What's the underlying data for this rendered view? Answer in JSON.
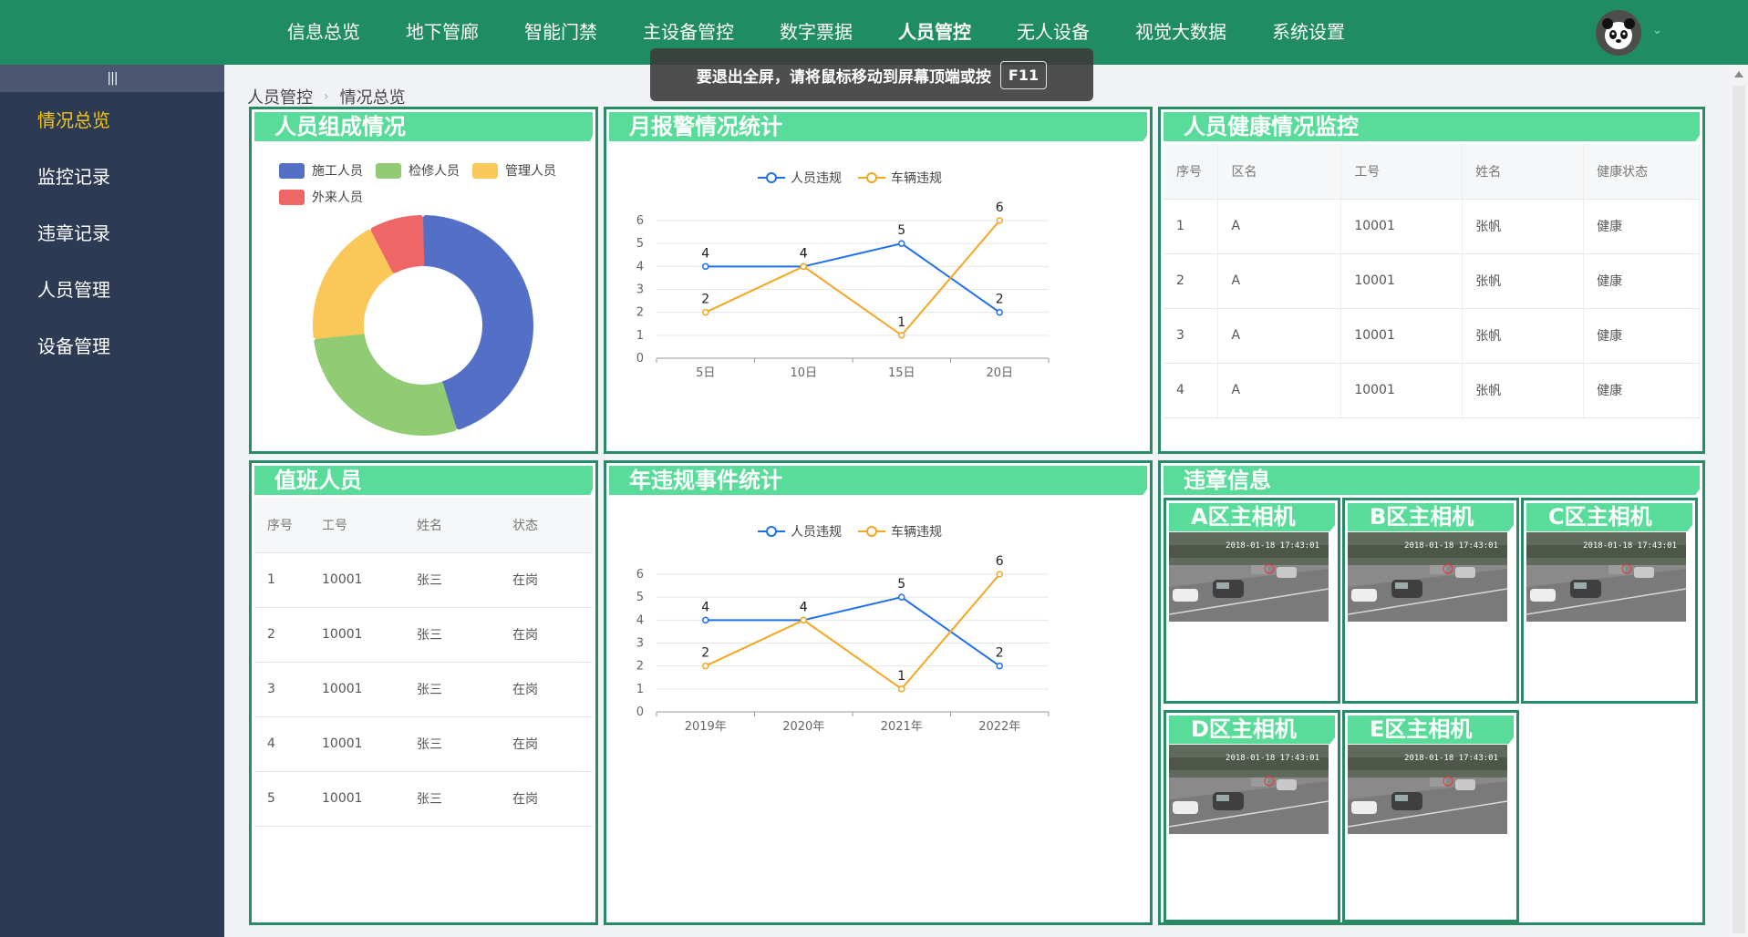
{
  "topnav": {
    "items": [
      {
        "label": "信息总览",
        "active": false
      },
      {
        "label": "地下管廊",
        "active": false
      },
      {
        "label": "智能门禁",
        "active": false
      },
      {
        "label": "主设备管控",
        "active": false
      },
      {
        "label": "数字票据",
        "active": false
      },
      {
        "label": "人员管控",
        "active": true
      },
      {
        "label": "无人设备",
        "active": false
      },
      {
        "label": "视觉大数据",
        "active": false
      },
      {
        "label": "系统设置",
        "active": false
      }
    ],
    "avatar_icon": "panda-avatar-icon",
    "caret_icon": "chevron-down-icon"
  },
  "fullscreen_toast": {
    "message": "要退出全屏，请将鼠标移动到屏幕顶端或按",
    "key": "F11"
  },
  "sidebar": {
    "toggle": "|||",
    "items": [
      {
        "label": "情况总览",
        "active": true
      },
      {
        "label": "监控记录",
        "active": false
      },
      {
        "label": "违章记录",
        "active": false
      },
      {
        "label": "人员管理",
        "active": false
      },
      {
        "label": "设备管理",
        "active": false
      }
    ]
  },
  "breadcrumb": {
    "parent": "人员管控",
    "current": "情况总览"
  },
  "panels": {
    "composition": {
      "title": "人员组成情况",
      "legend": [
        {
          "name": "施工人员",
          "color": "#5470c6"
        },
        {
          "name": "检修人员",
          "color": "#91cc75"
        },
        {
          "name": "管理人员",
          "color": "#fac858"
        },
        {
          "name": "外来人员",
          "color": "#ee6666"
        }
      ]
    },
    "monthly": {
      "title": "月报警情况统计"
    },
    "health": {
      "title": "人员健康情况监控",
      "columns": [
        "序号",
        "区名",
        "工号",
        "姓名",
        "健康状态"
      ],
      "rows": [
        [
          "1",
          "A",
          "10001",
          "张帆",
          "健康"
        ],
        [
          "2",
          "A",
          "10001",
          "张帆",
          "健康"
        ],
        [
          "3",
          "A",
          "10001",
          "张帆",
          "健康"
        ],
        [
          "4",
          "A",
          "10001",
          "张帆",
          "健康"
        ]
      ]
    },
    "duty": {
      "title": "值班人员",
      "columns": [
        "序号",
        "工号",
        "姓名",
        "状态"
      ],
      "rows": [
        [
          "1",
          "10001",
          "张三",
          "在岗"
        ],
        [
          "2",
          "10001",
          "张三",
          "在岗"
        ],
        [
          "3",
          "10001",
          "张三",
          "在岗"
        ],
        [
          "4",
          "10001",
          "张三",
          "在岗"
        ],
        [
          "5",
          "10001",
          "张三",
          "在岗"
        ]
      ]
    },
    "yearly": {
      "title": "年违规事件统计"
    },
    "violation": {
      "title": "违章信息",
      "cameras": [
        {
          "label": "A区主相机",
          "timestamp": "2018-01-18 17:43:01"
        },
        {
          "label": "B区主相机",
          "timestamp": "2018-01-18 17:43:01"
        },
        {
          "label": "C区主相机",
          "timestamp": "2018-01-18 17:43:01"
        },
        {
          "label": "D区主相机",
          "timestamp": "2018-01-18 17:43:01"
        },
        {
          "label": "E区主相机",
          "timestamp": "2018-01-18 17:43:01"
        }
      ]
    }
  },
  "chart_data": [
    {
      "type": "pie",
      "title": "人员组成情况",
      "labels": [
        "施工人员",
        "检修人员",
        "管理人员",
        "外来人员"
      ],
      "values": [
        45,
        28,
        19,
        8
      ],
      "colors": [
        "#5470c6",
        "#91cc75",
        "#fac858",
        "#ee6666"
      ],
      "donut": true
    },
    {
      "type": "line",
      "title": "月报警情况统计",
      "categories": [
        "5日",
        "10日",
        "15日",
        "20日"
      ],
      "series": [
        {
          "name": "人员违规",
          "values": [
            4,
            4,
            5,
            2
          ],
          "color": "#1f6fee"
        },
        {
          "name": "车辆违规",
          "values": [
            2,
            4,
            1,
            6
          ],
          "color": "#f5a623"
        }
      ],
      "ylim": [
        0,
        6
      ],
      "yticks": [
        0,
        1,
        2,
        3,
        4,
        5,
        6
      ],
      "grid": true,
      "legend": "top-center"
    },
    {
      "type": "line",
      "title": "年违规事件统计",
      "categories": [
        "2019年",
        "2020年",
        "2021年",
        "2022年"
      ],
      "series": [
        {
          "name": "人员违规",
          "values": [
            4,
            4,
            5,
            2
          ],
          "color": "#1f6fee"
        },
        {
          "name": "车辆违规",
          "values": [
            2,
            4,
            1,
            6
          ],
          "color": "#f5a623"
        }
      ],
      "ylim": [
        0,
        6
      ],
      "yticks": [
        0,
        1,
        2,
        3,
        4,
        5,
        6
      ],
      "grid": true,
      "legend": "top-center"
    }
  ]
}
